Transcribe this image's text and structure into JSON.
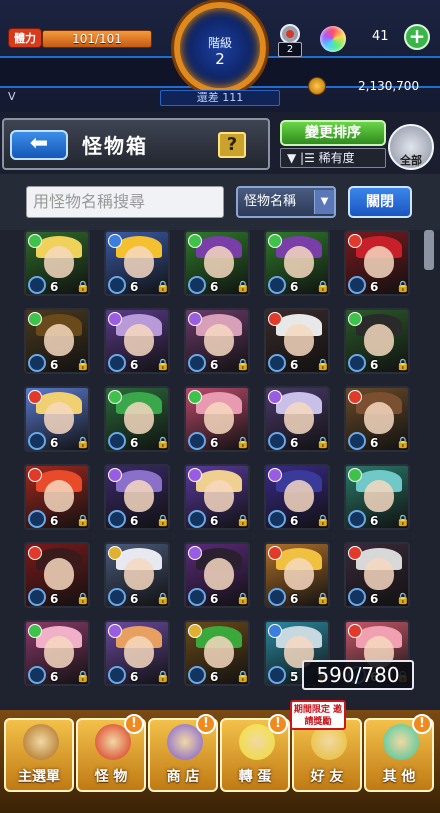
{
  "status": {
    "stamina_label": "體力",
    "stamina_value": "101/101",
    "level_title": "階級",
    "level_value": "2",
    "exp_remaining": "還差 111",
    "v_label": "V",
    "cup_count": "2",
    "orb_count": "41",
    "coin_count": "2,130,700"
  },
  "header": {
    "back_arrow": "⬅",
    "title": "怪物箱",
    "help": "?",
    "sort_button": "變更排序",
    "sort_field": "▼ |☰ 稀有度",
    "all_button": "全部"
  },
  "search": {
    "placeholder": "用怪物名稱搜尋",
    "filter_value": "怪物名稱",
    "filter_arrow": "▼",
    "close_button": "關閉"
  },
  "box": {
    "count": "590/780",
    "monsters": [
      {
        "level": "6",
        "bg": "#2e6b2a",
        "hair": "#f0d25a",
        "elem": "#3ec24a"
      },
      {
        "level": "6",
        "bg": "#3a5ba8",
        "hair": "#f4c030",
        "elem": "#3a7ee0"
      },
      {
        "level": "6",
        "bg": "#2f7a2a",
        "hair": "#7a3ea8",
        "elem": "#3ec24a"
      },
      {
        "level": "6",
        "bg": "#2f7a2a",
        "hair": "#7a3ea8",
        "elem": "#3ec24a"
      },
      {
        "level": "6",
        "bg": "#7a1a1e",
        "hair": "#c8202a",
        "elem": "#e23a2a"
      },
      {
        "level": "6",
        "bg": "#4a3a1e",
        "hair": "#6a4a1a",
        "elem": "#3ec24a"
      },
      {
        "level": "6",
        "bg": "#5a3a8a",
        "hair": "#b89ad8",
        "elem": "#9a5ce0"
      },
      {
        "level": "6",
        "bg": "#6a3a6a",
        "hair": "#d8a0b8",
        "elem": "#9a5ce0"
      },
      {
        "level": "6",
        "bg": "#3a2a2a",
        "hair": "#e8e8e8",
        "elem": "#e23a2a"
      },
      {
        "level": "6",
        "bg": "#2a5a2a",
        "hair": "#2a2a2a",
        "elem": "#3ec24a"
      },
      {
        "level": "6",
        "bg": "#5a7ad0",
        "hair": "#f0d070",
        "elem": "#e23a2a"
      },
      {
        "level": "6",
        "bg": "#2a6a3a",
        "hair": "#3aa84a",
        "elem": "#3ec24a"
      },
      {
        "level": "6",
        "bg": "#b84a6a",
        "hair": "#e89ab0",
        "elem": "#3ec24a"
      },
      {
        "level": "6",
        "bg": "#4a3a6a",
        "hair": "#c8c0e8",
        "elem": "#9a5ce0"
      },
      {
        "level": "6",
        "bg": "#6a4a2a",
        "hair": "#7a5030",
        "elem": "#e23a2a"
      },
      {
        "level": "6",
        "bg": "#a0281e",
        "hair": "#e84a2a",
        "elem": "#e23a2a"
      },
      {
        "level": "6",
        "bg": "#3a2a6a",
        "hair": "#8a70c8",
        "elem": "#9a5ce0"
      },
      {
        "level": "6",
        "bg": "#5a3aa0",
        "hair": "#f0d090",
        "elem": "#9a5ce0"
      },
      {
        "level": "6",
        "bg": "#3a2a8a",
        "hair": "#3a3a9a",
        "elem": "#9a5ce0"
      },
      {
        "level": "6",
        "bg": "#2a7a6a",
        "hair": "#70c8c8",
        "elem": "#3ec24a"
      },
      {
        "level": "6",
        "bg": "#7a1a1a",
        "hair": "#3a1a1a",
        "elem": "#e23a2a"
      },
      {
        "level": "6",
        "bg": "#4a5a7a",
        "hair": "#e8e8f0",
        "elem": "#e0b030"
      },
      {
        "level": "6",
        "bg": "#5a2a7a",
        "hair": "#2a2030",
        "elem": "#9a5ce0"
      },
      {
        "level": "6",
        "bg": "#b0702a",
        "hair": "#f0c040",
        "elem": "#e23a2a"
      },
      {
        "level": "6",
        "bg": "#3a2a3a",
        "hair": "#d8d8d8",
        "elem": "#e23a2a"
      },
      {
        "level": "6",
        "bg": "#8a3a6a",
        "hair": "#f0b0c8",
        "elem": "#3ec24a"
      },
      {
        "level": "6",
        "bg": "#6a4aa0",
        "hair": "#e8a060",
        "elem": "#9a5ce0"
      },
      {
        "level": "6",
        "bg": "#6a4a1a",
        "hair": "#3aa83a",
        "elem": "#e0b030"
      },
      {
        "level": "5",
        "bg": "#2a8aa0",
        "hair": "#c8d8e0",
        "elem": "#3a7ee0"
      },
      {
        "level": "6",
        "bg": "#c8586a",
        "hair": "#f0a0b0",
        "elem": "#e23a2a"
      }
    ]
  },
  "nav": {
    "items": [
      {
        "label": "主選單",
        "icon": "#a86a1a"
      },
      {
        "label": "怪 物",
        "icon": "#d8301c"
      },
      {
        "label": "商 店",
        "icon": "#7a5ad8"
      },
      {
        "label": "轉 蛋",
        "icon": "#f0e030"
      },
      {
        "label": "好 友",
        "icon": "#e8c030"
      },
      {
        "label": "其 他",
        "icon": "#3ac8a0"
      }
    ],
    "badge": "!",
    "limited_text": "期間限定 邀請獎勵"
  }
}
